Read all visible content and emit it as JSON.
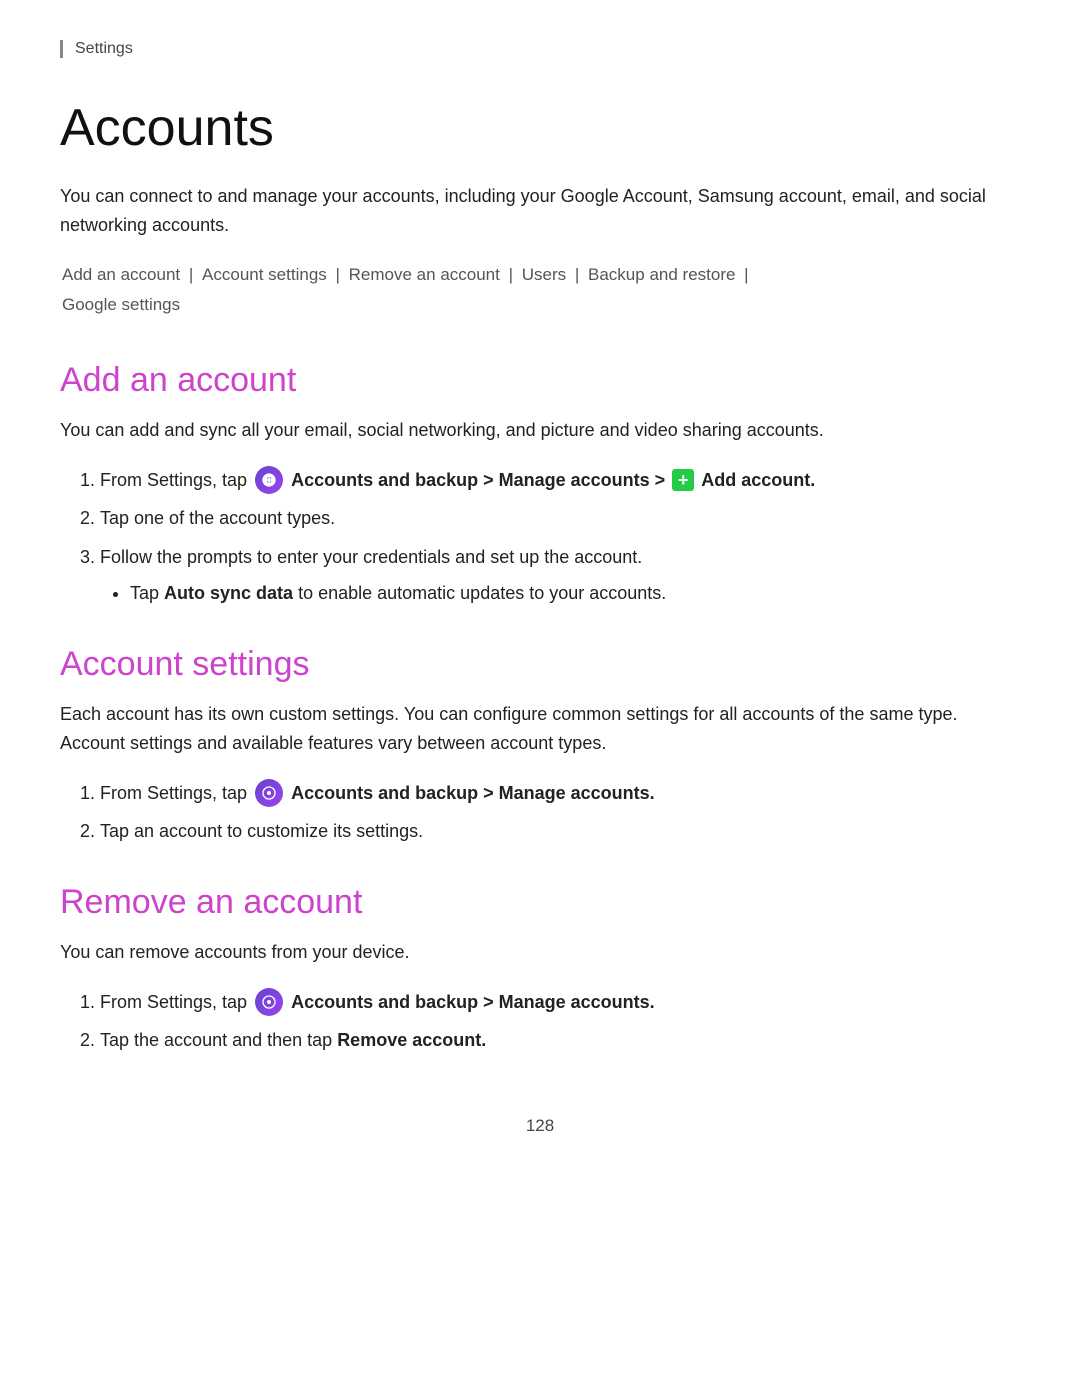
{
  "breadcrumb": "Settings",
  "page_title": "Accounts",
  "intro_text": "You can connect to and manage your accounts, including your Google Account, Samsung account, email, and social networking accounts.",
  "nav_links": {
    "add_account": "Add an account",
    "account_settings": "Account settings",
    "remove_account": "Remove an account",
    "users": "Users",
    "backup_restore": "Backup and restore",
    "google_settings": "Google settings",
    "separator": "|"
  },
  "sections": {
    "add_account": {
      "title": "Add an account",
      "description": "You can add and sync all your email, social networking, and picture and video sharing accounts.",
      "steps": [
        {
          "text_before_bold": "From Settings, tap ",
          "bold_text": "Accounts and backup > Manage accounts >",
          "text_after_bold": " Add account.",
          "has_icon": true,
          "has_plus": true,
          "plus_label": "Add account."
        },
        {
          "text": "Tap one of the account types."
        },
        {
          "text": "Follow the prompts to enter your credentials and set up the account.",
          "sub_bullets": [
            {
              "text_before_bold": "Tap ",
              "bold_text": "Auto sync data",
              "text_after_bold": " to enable automatic updates to your accounts."
            }
          ]
        }
      ]
    },
    "account_settings": {
      "title": "Account settings",
      "description": "Each account has its own custom settings. You can configure common settings for all accounts of the same type. Account settings and available features vary between account types.",
      "steps": [
        {
          "text_before_bold": "From Settings, tap ",
          "bold_text": "Accounts and backup > Manage accounts.",
          "has_icon": true
        },
        {
          "text": "Tap an account to customize its settings."
        }
      ]
    },
    "remove_account": {
      "title": "Remove an account",
      "description": "You can remove accounts from your device.",
      "steps": [
        {
          "text_before_bold": "From Settings, tap ",
          "bold_text": "Accounts and backup > Manage accounts.",
          "has_icon": true
        },
        {
          "text_before_bold": "Tap the account and then tap ",
          "bold_text": "Remove account."
        }
      ]
    }
  },
  "page_number": "128"
}
